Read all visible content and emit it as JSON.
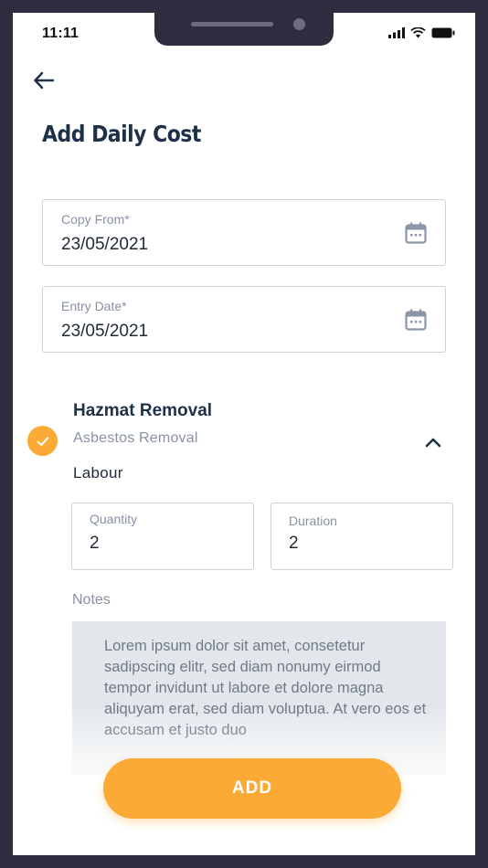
{
  "status_bar": {
    "time": "11:11"
  },
  "header": {
    "title": "Add Daily Cost"
  },
  "form": {
    "copy_from": {
      "label": "Copy From*",
      "value": "23/05/2021"
    },
    "entry_date": {
      "label": "Entry Date*",
      "value": "23/05/2021"
    }
  },
  "section": {
    "title": "Hazmat Removal",
    "subtitle": "Asbestos Removal",
    "category": "Labour",
    "quantity": {
      "label": "Quantity",
      "value": "2"
    },
    "duration": {
      "label": "Duration",
      "value": "2"
    },
    "notes_label": "Notes",
    "notes_text": "Lorem ipsum dolor sit amet, consetetur sadipscing elitr, sed diam nonumy eirmod tempor invidunt ut labore et dolore magna aliquyam erat, sed diam voluptua. At vero eos et accusam et justo duo"
  },
  "actions": {
    "add_label": "ADD"
  },
  "icons": [
    "back-arrow-icon",
    "calendar-icon",
    "check-icon",
    "chevron-up-icon",
    "signal-icon",
    "wifi-icon",
    "battery-icon"
  ],
  "colors": {
    "accent": "#fbaa35",
    "title": "#1e3148",
    "label": "#8792a2",
    "frame": "#2e2d40"
  }
}
